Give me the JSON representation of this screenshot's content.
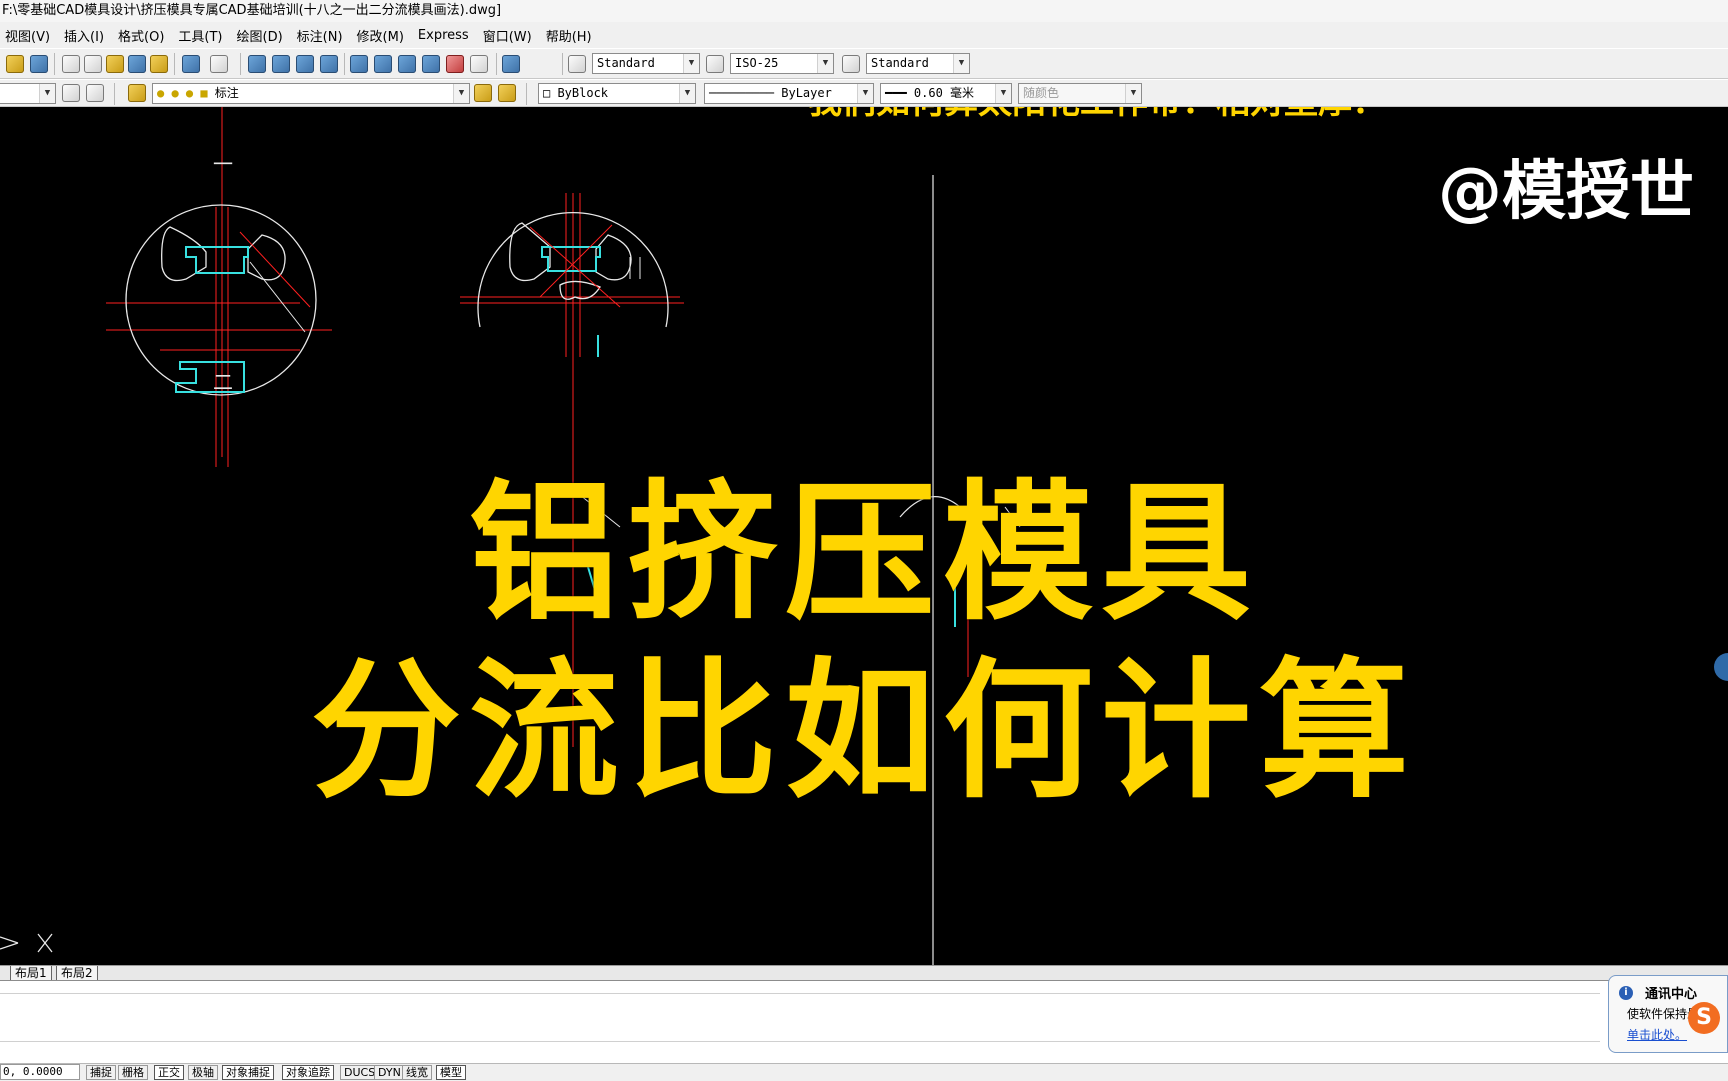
{
  "window": {
    "title": "F:\\零基础CAD模具设计\\挤压模具专属CAD基础培训(十八之一出二分流模具画法).dwg]"
  },
  "menu": {
    "items": [
      "视图(V)",
      "插入(I)",
      "格式(O)",
      "工具(T)",
      "绘图(D)",
      "标注(N)",
      "修改(M)",
      "Express",
      "窗口(W)",
      "帮助(H)"
    ]
  },
  "toolbar": {
    "text_style": "Standard",
    "dim_style": "ISO-25",
    "table_style": "Standard",
    "layer": "标注",
    "color": "ByBlock",
    "linetype": "ByLayer",
    "lineweight": "0.60 毫米",
    "plot_style": "随颜色"
  },
  "canvas": {
    "subtitle_partial": "我们如何算太阳花工作带：相对壁厚：",
    "watermark": "@模授世",
    "overlay_line1": "铝挤压模具",
    "overlay_line2": "分流比如何计算",
    "section_marks": [
      "一",
      "二"
    ]
  },
  "tabs": [
    "布局1",
    "布局2"
  ],
  "status": {
    "coords": "0, 0.0000",
    "buttons": [
      "捕捉",
      "栅格",
      "正交",
      "极轴",
      "对象捕捉",
      "对象追踪",
      "DUCS",
      "DYN",
      "线宽",
      "模型"
    ]
  },
  "notification": {
    "title": "通讯中心",
    "body": "使软件保持最",
    "link": "单击此处。"
  },
  "colors": {
    "overlay_yellow": "#ffd500",
    "cad_background": "#000000",
    "centerline_red": "#ff2020",
    "profile_cyan": "#38e0e0"
  }
}
